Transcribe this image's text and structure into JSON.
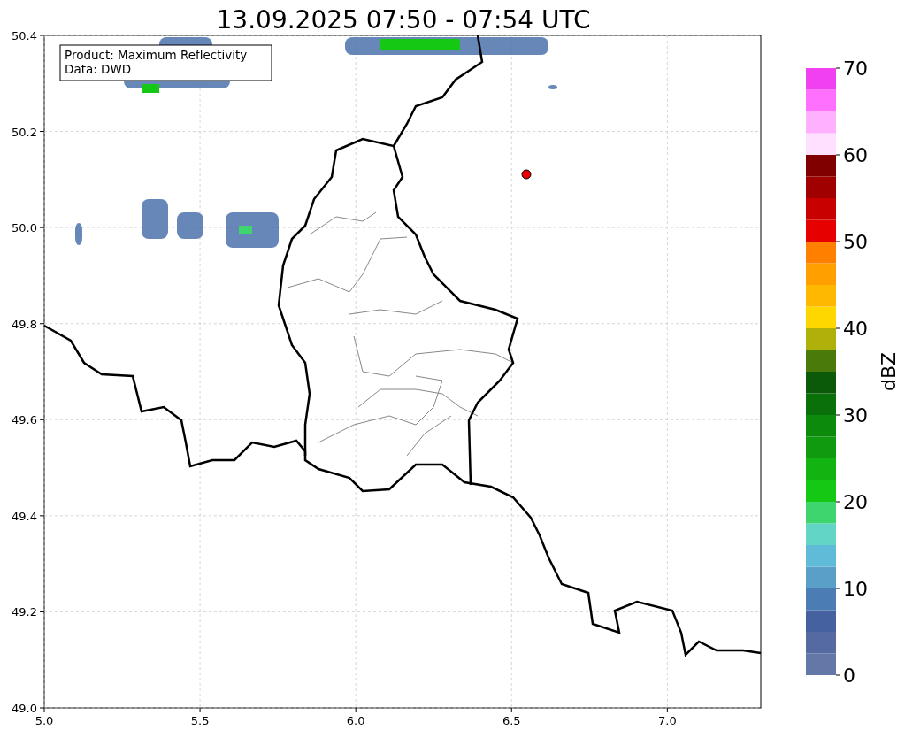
{
  "title": "13.09.2025 07:50 - 07:54 UTC",
  "legend": [
    "Product: Maximum Reflectivity",
    "Data: DWD"
  ],
  "map": {
    "xticks": [
      "5.0",
      "5.5",
      "6.0",
      "6.5",
      "7.0"
    ],
    "yticks": [
      "50.4",
      "50.2",
      "50.0",
      "49.8",
      "49.6",
      "49.4",
      "49.2",
      "49.0"
    ]
  },
  "colorbar": {
    "label": "dBZ",
    "ticks": [
      "70",
      "60",
      "50",
      "40",
      "30",
      "20",
      "10",
      "0"
    ],
    "segments": [
      {
        "color": "#6478a8"
      },
      {
        "color": "#566aa2"
      },
      {
        "color": "#4661a0"
      },
      {
        "color": "#4c7cb4"
      },
      {
        "color": "#5a9fc8"
      },
      {
        "color": "#60bbd8"
      },
      {
        "color": "#62d5c7"
      },
      {
        "color": "#3ed56e"
      },
      {
        "color": "#14c814"
      },
      {
        "color": "#12b412"
      },
      {
        "color": "#0f9a0f"
      },
      {
        "color": "#0c8a0c"
      },
      {
        "color": "#0a700a"
      },
      {
        "color": "#0a5a0a"
      },
      {
        "color": "#4a7a0a"
      },
      {
        "color": "#b0b00a"
      },
      {
        "color": "#ffd700"
      },
      {
        "color": "#ffb800"
      },
      {
        "color": "#ff9f00"
      },
      {
        "color": "#ff7f00"
      },
      {
        "color": "#e60000"
      },
      {
        "color": "#c80000"
      },
      {
        "color": "#a00000"
      },
      {
        "color": "#800000"
      },
      {
        "color": "#ffe0ff"
      },
      {
        "color": "#ffb0ff"
      },
      {
        "color": "#ff70ff"
      },
      {
        "color": "#f040f0"
      }
    ]
  }
}
